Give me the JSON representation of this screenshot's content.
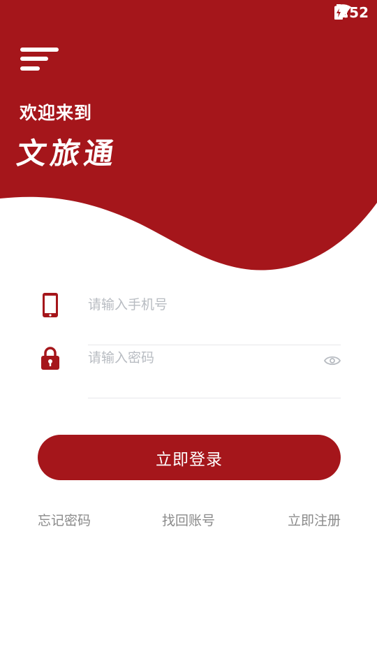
{
  "status_bar": {
    "time": "3:52"
  },
  "header": {
    "welcome_text": "欢迎来到",
    "brand_name": "文旅通"
  },
  "form": {
    "phone": {
      "placeholder": "请输入手机号",
      "value": ""
    },
    "password": {
      "placeholder": "请输入密码",
      "value": ""
    }
  },
  "actions": {
    "login_label": "立即登录"
  },
  "links": {
    "forgot_password": "忘记密码",
    "recover_account": "找回账号",
    "register": "立即注册"
  },
  "colors": {
    "brand": "#a5161b",
    "placeholder": "#b8bcc2",
    "link": "#8a8a8a"
  }
}
